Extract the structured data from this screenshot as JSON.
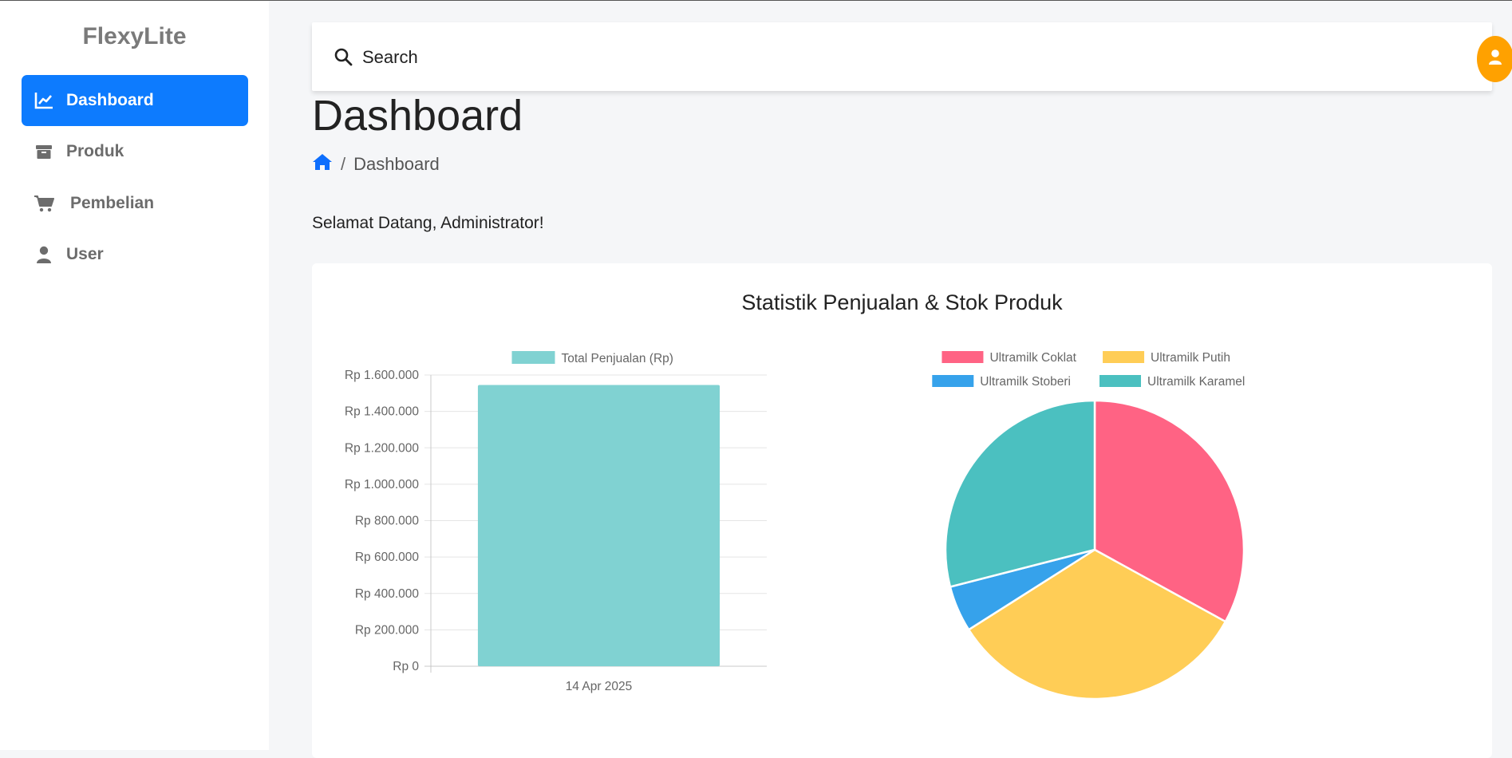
{
  "app": {
    "brand": "FlexyLite"
  },
  "sidebar": {
    "items": [
      {
        "label": "Dashboard",
        "icon": "chart-line-icon",
        "active": true
      },
      {
        "label": "Produk",
        "icon": "box-icon",
        "active": false
      },
      {
        "label": "Pembelian",
        "icon": "cart-icon",
        "active": false
      },
      {
        "label": "User",
        "icon": "user-icon",
        "active": false
      }
    ]
  },
  "topbar": {
    "search_placeholder": "Search",
    "avatar_icon": "user-icon",
    "avatar_color": "#ffa100"
  },
  "page": {
    "title": "Dashboard",
    "breadcrumb": {
      "separator": "/",
      "current": "Dashboard"
    },
    "welcome": "Selamat Datang, Administrator!"
  },
  "card": {
    "title": "Statistik Penjualan & Stok Produk"
  },
  "colors": {
    "accent": "#0d7bfe",
    "bar": "#80d2d2",
    "pie": [
      "#ff6384",
      "#ffcd56",
      "#36a2eb",
      "#4bc0c0"
    ]
  },
  "chart_data": [
    {
      "type": "bar",
      "categories": [
        "14 Apr 2025"
      ],
      "series": [
        {
          "name": "Total Penjualan (Rp)",
          "values": [
            1545000
          ]
        }
      ],
      "ylim": [
        0,
        1600000
      ],
      "yticks": [
        0,
        200000,
        400000,
        600000,
        800000,
        1000000,
        1200000,
        1400000,
        1600000
      ],
      "ytick_labels": [
        "Rp 0",
        "Rp 200.000",
        "Rp 400.000",
        "Rp 600.000",
        "Rp 800.000",
        "Rp 1.000.000",
        "Rp 1.200.000",
        "Rp 1.400.000",
        "Rp 1.600.000"
      ],
      "grid": true,
      "legend": "top"
    },
    {
      "type": "pie",
      "labels": [
        "Ultramilk Coklat",
        "Ultramilk Putih",
        "Ultramilk Stoberi",
        "Ultramilk Karamel"
      ],
      "values": [
        33,
        33,
        5,
        29
      ],
      "legend": "top"
    }
  ]
}
